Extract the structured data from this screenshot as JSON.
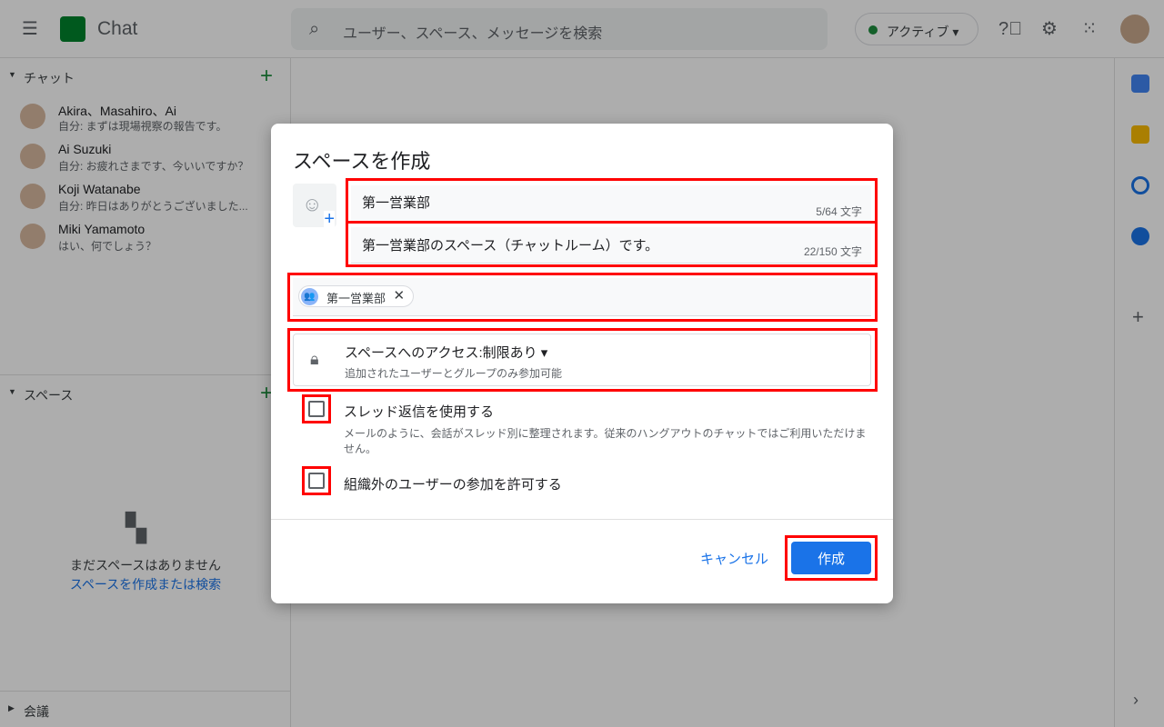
{
  "header": {
    "app_title": "Chat",
    "search_placeholder": "ユーザー、スペース、メッセージを検索",
    "status": "アクティブ",
    "accent": "#1a73e8"
  },
  "sidebar": {
    "chat_section": "チャット",
    "chats": [
      {
        "name": "Akira、Masahiro、Ai",
        "message": "自分: まずは現場視察の報告です。"
      },
      {
        "name": "Ai Suzuki",
        "message": "自分: お疲れさまです、今いいですか？"
      },
      {
        "name": "Koji Watanabe",
        "message": "自分: 昨日はありがとうございました..."
      },
      {
        "name": "Miki Yamamoto",
        "message": "はい、何でしょう？"
      }
    ],
    "space_section": "スペース",
    "empty_text": "まだスペースはありません",
    "empty_link": "スペースを作成または検索",
    "meeting_section": "会議"
  },
  "dialog": {
    "title": "スペースを作成",
    "name_value": "第一営業部",
    "name_count": "5/64 文字",
    "desc_value": "第一営業部のスペース（チャットルーム）です。",
    "desc_count": "22/150 文字",
    "chip": "第一営業部",
    "access_title": "スペースへのアクセス:制限あり",
    "access_sub": "追加されたユーザーとグループのみ参加可能",
    "thread_label": "スレッド返信を使用する",
    "thread_desc": "メールのように、会話がスレッド別に整理されます。従来のハングアウトのチャットではご利用いただけません。",
    "thread_checked": false,
    "external_label": "組織外のユーザーの参加を許可する",
    "external_checked": false,
    "cancel": "キャンセル",
    "create": "作成"
  }
}
